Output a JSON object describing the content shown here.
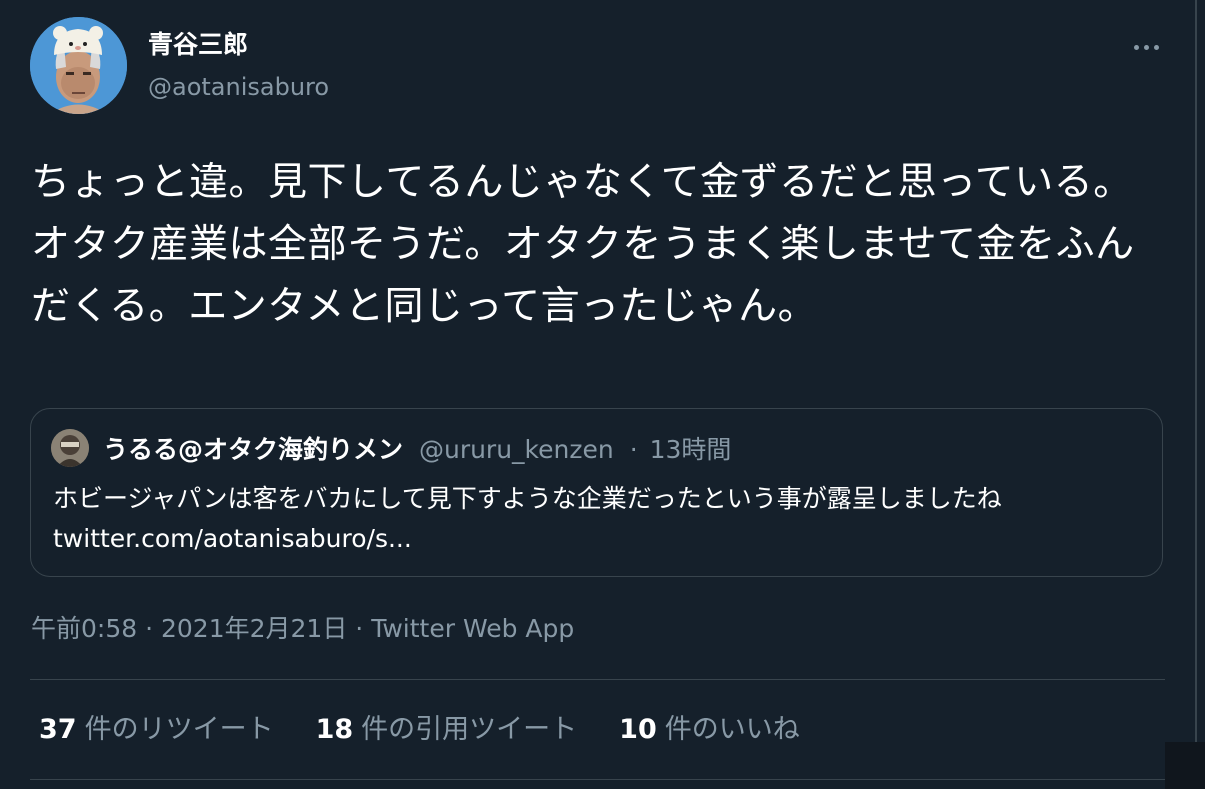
{
  "tweet": {
    "author": {
      "display_name": "青谷三郎",
      "handle": "@aotanisaburo"
    },
    "more_icon": "more-horizontal-icon",
    "text": "ちょっと違。見下してるんじゃなくて金ずるだと思っている。オタク産業は全部そうだ。オタクをうまく楽しませて金をふんだくる。エンタメと同じって言ったじゃん。",
    "quoted": {
      "display_name": "うるる@オタク海釣りメン",
      "handle": "@ururu_kenzen",
      "separator": "·",
      "time": "13時間",
      "text": "ホビージャパンは客をバカにして見下すような企業だったという事が露呈しましたね twitter.com/aotanisaburo/s..."
    },
    "timestamp": {
      "time": "午前0:58",
      "date": "2021年2月21日",
      "source": "Twitter Web App",
      "separator": "·"
    },
    "stats": {
      "retweets": {
        "count": "37",
        "label": "件のリツイート"
      },
      "quotes": {
        "count": "18",
        "label": "件の引用ツイート"
      },
      "likes": {
        "count": "10",
        "label": "件のいいね"
      }
    }
  },
  "colors": {
    "background": "#15202b",
    "secondary_text": "#8899a6",
    "border": "#38444d",
    "primary_text": "#ffffff"
  }
}
